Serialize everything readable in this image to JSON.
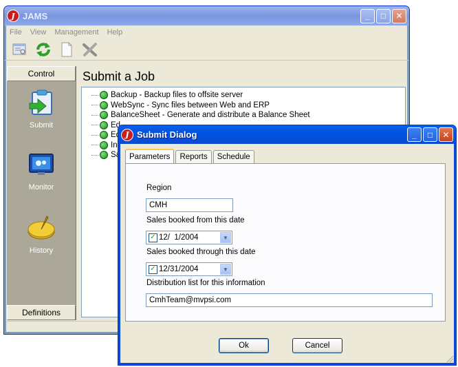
{
  "main_window": {
    "title": "JAMS",
    "menu": [
      "File",
      "View",
      "Management",
      "Help"
    ],
    "sidebar": {
      "header": "Control",
      "items": [
        {
          "label": "Submit",
          "icon": "submit-icon"
        },
        {
          "label": "Monitor",
          "icon": "monitor-icon"
        },
        {
          "label": "History",
          "icon": "history-icon"
        }
      ],
      "footer": "Definitions"
    },
    "content_title": "Submit a Job",
    "jobs": [
      "Backup - Backup files to offsite server",
      "WebSync - Sync files between Web and ERP",
      "BalanceSheet - Generate and distribute a Balance Sheet",
      "Ed",
      "Ed",
      "In",
      "Sa"
    ]
  },
  "dialog": {
    "title": "Submit Dialog",
    "tabs": [
      "Parameters",
      "Reports",
      "Schedule"
    ],
    "fields": {
      "region_label": "Region",
      "region_value": "CMH",
      "from_label": "Sales booked from this date",
      "from_value": "12/  1/2004",
      "through_label": "Sales booked through this date",
      "through_value": "12/31/2004",
      "dist_label": "Distribution list for this information",
      "dist_value": "CmhTeam@mvpsi.com"
    },
    "buttons": {
      "ok": "Ok",
      "cancel": "Cancel"
    }
  },
  "colors": {
    "titlebar": "#0054e3",
    "face": "#ece9d8",
    "sidebar": "#aca899"
  }
}
